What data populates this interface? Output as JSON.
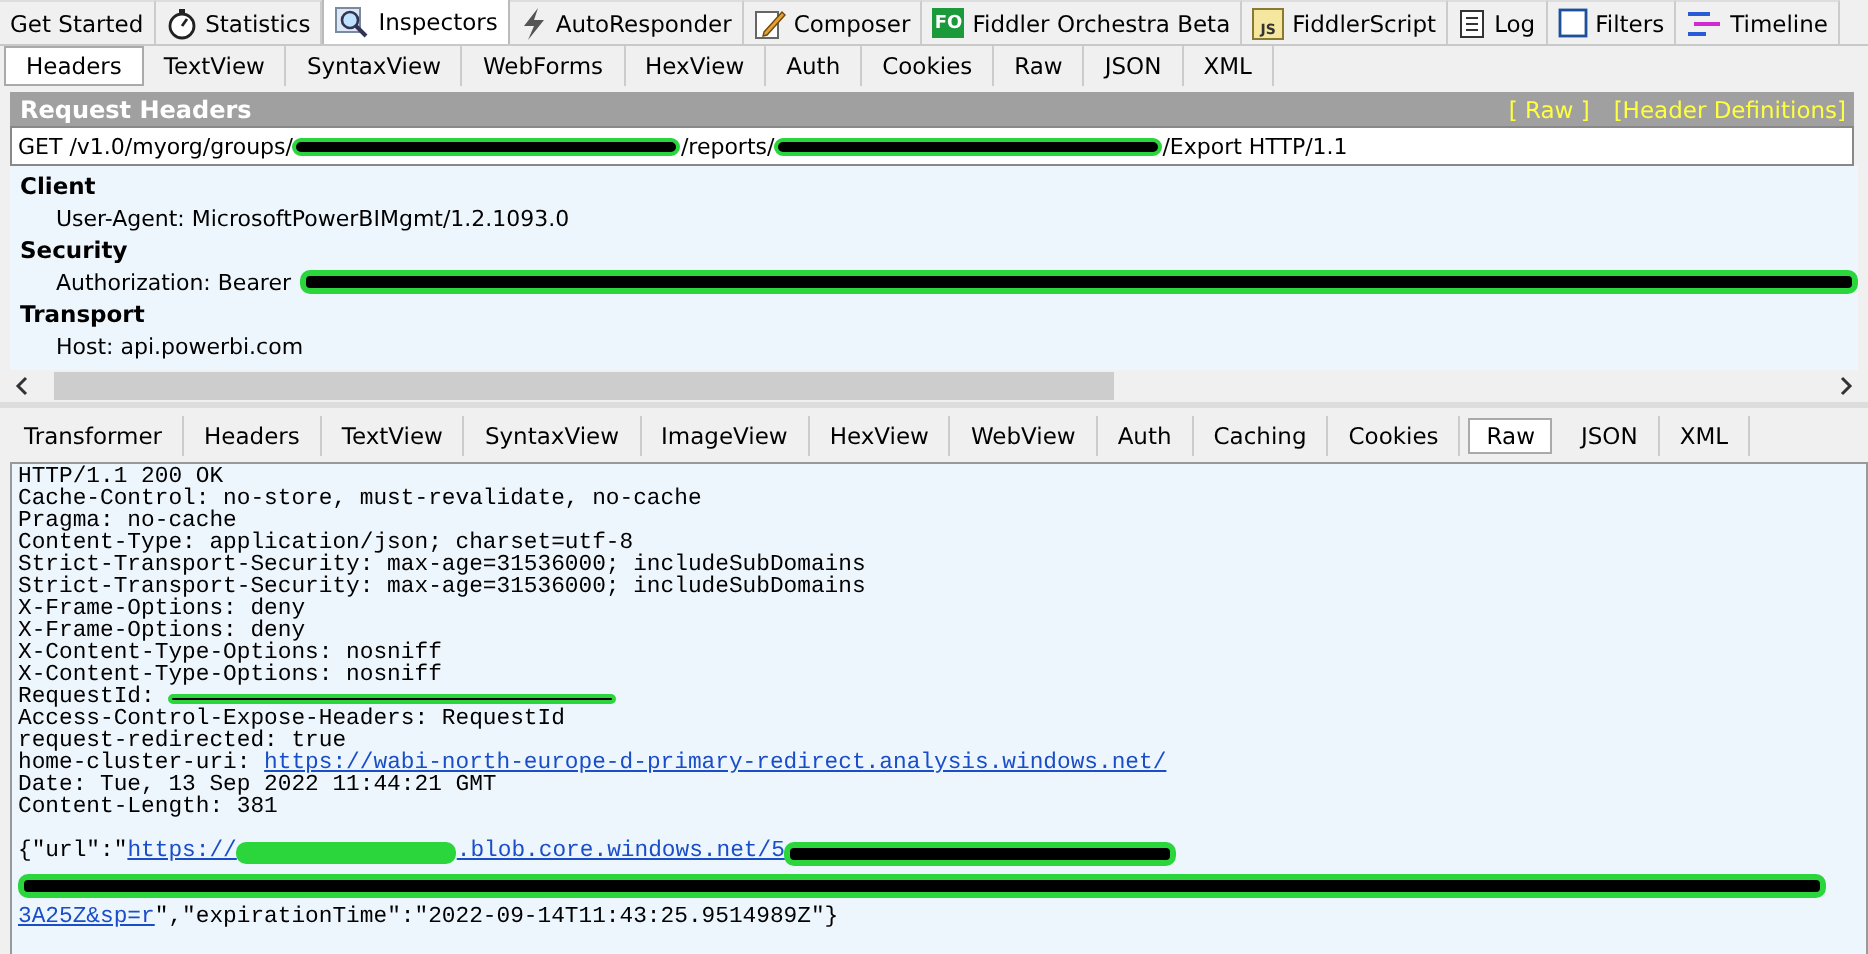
{
  "main_tabs": [
    {
      "label": "Get Started",
      "selected": false
    },
    {
      "label": "Statistics",
      "selected": false
    },
    {
      "label": "Inspectors",
      "selected": true
    },
    {
      "label": "AutoResponder",
      "selected": false
    },
    {
      "label": "Composer",
      "selected": false
    },
    {
      "label": "Fiddler Orchestra Beta",
      "badge": "FO",
      "selected": false
    },
    {
      "label": "FiddlerScript",
      "badge": "JS",
      "selected": false
    },
    {
      "label": "Log",
      "selected": false
    },
    {
      "label": "Filters",
      "selected": false
    },
    {
      "label": "Timeline",
      "selected": false
    }
  ],
  "request": {
    "tabs": [
      {
        "label": "Headers",
        "selected": true
      },
      {
        "label": "TextView",
        "selected": false
      },
      {
        "label": "SyntaxView",
        "selected": false
      },
      {
        "label": "WebForms",
        "selected": false
      },
      {
        "label": "HexView",
        "selected": false
      },
      {
        "label": "Auth",
        "selected": false
      },
      {
        "label": "Cookies",
        "selected": false
      },
      {
        "label": "Raw",
        "selected": false
      },
      {
        "label": "JSON",
        "selected": false
      },
      {
        "label": "XML",
        "selected": false
      }
    ],
    "title": "Request Headers",
    "links": [
      "[ Raw ]",
      "[Header Definitions]"
    ],
    "request_line": [
      {
        "kind": "text",
        "text": "GET /v1.0/myorg/groups/"
      },
      {
        "kind": "redacted"
      },
      {
        "kind": "text",
        "text": "/reports/"
      },
      {
        "kind": "redacted"
      },
      {
        "kind": "text",
        "text": "/Export HTTP/1.1"
      }
    ],
    "groups": [
      {
        "name": "Client",
        "headers": [
          [
            {
              "kind": "text",
              "text": "User-Agent: MicrosoftPowerBIMgmt/1.2.1093.0"
            }
          ]
        ]
      },
      {
        "name": "Security",
        "headers": [
          [
            {
              "kind": "text",
              "text": "Authorization: Bearer"
            },
            {
              "kind": "redacted"
            }
          ]
        ]
      },
      {
        "name": "Transport",
        "headers": [
          [
            {
              "kind": "text",
              "text": "Host: api.powerbi.com"
            }
          ]
        ]
      }
    ]
  },
  "response": {
    "tabs": [
      {
        "label": "Transformer",
        "selected": false
      },
      {
        "label": "Headers",
        "selected": false
      },
      {
        "label": "TextView",
        "selected": false
      },
      {
        "label": "SyntaxView",
        "selected": false
      },
      {
        "label": "ImageView",
        "selected": false
      },
      {
        "label": "HexView",
        "selected": false
      },
      {
        "label": "WebView",
        "selected": false
      },
      {
        "label": "Auth",
        "selected": false
      },
      {
        "label": "Caching",
        "selected": false
      },
      {
        "label": "Cookies",
        "selected": false
      },
      {
        "label": "Raw",
        "selected": true
      },
      {
        "label": "JSON",
        "selected": false
      },
      {
        "label": "XML",
        "selected": false
      }
    ],
    "head_lines": [
      [
        {
          "kind": "text",
          "text": "HTTP/1.1 200 OK"
        }
      ],
      [
        {
          "kind": "text",
          "text": "Cache-Control: no-store, must-revalidate, no-cache"
        }
      ],
      [
        {
          "kind": "text",
          "text": "Pragma: no-cache"
        }
      ],
      [
        {
          "kind": "text",
          "text": "Content-Type: application/json; charset=utf-8"
        }
      ],
      [
        {
          "kind": "text",
          "text": "Strict-Transport-Security: max-age=31536000; includeSubDomains"
        }
      ],
      [
        {
          "kind": "text",
          "text": "Strict-Transport-Security: max-age=31536000; includeSubDomains"
        }
      ],
      [
        {
          "kind": "text",
          "text": "X-Frame-Options: deny"
        }
      ],
      [
        {
          "kind": "text",
          "text": "X-Frame-Options: deny"
        }
      ],
      [
        {
          "kind": "text",
          "text": "X-Content-Type-Options: nosniff"
        }
      ],
      [
        {
          "kind": "text",
          "text": "X-Content-Type-Options: nosniff"
        }
      ],
      [
        {
          "kind": "text",
          "text": "RequestId: "
        },
        {
          "kind": "struck"
        }
      ],
      [
        {
          "kind": "text",
          "text": "Access-Control-Expose-Headers: RequestId"
        }
      ],
      [
        {
          "kind": "text",
          "text": "request-redirected: true"
        }
      ],
      [
        {
          "kind": "text",
          "text": "home-cluster-uri: "
        },
        {
          "kind": "link",
          "text": "https://wabi-north-europe-d-primary-redirect.analysis.windows.net/"
        }
      ],
      [
        {
          "kind": "text",
          "text": "Date: Tue, 13 Sep 2022 11:44:21 GMT"
        }
      ],
      [
        {
          "kind": "text",
          "text": "Content-Length: 381"
        }
      ]
    ],
    "body_lines": [
      [
        {
          "kind": "text",
          "text": "{\"url\":\""
        },
        {
          "kind": "link",
          "text": "https://"
        },
        {
          "kind": "masked"
        },
        {
          "kind": "link",
          "text": ".blob.core.windows.net/5"
        },
        {
          "kind": "redacted"
        }
      ],
      [
        {
          "kind": "redacted"
        }
      ],
      [
        {
          "kind": "link",
          "text": "3A25Z&sp=r"
        },
        {
          "kind": "text",
          "text": "\",\"expirationTime\":\"2022-09-14T11:43:25.9514989Z\"}"
        }
      ]
    ]
  }
}
